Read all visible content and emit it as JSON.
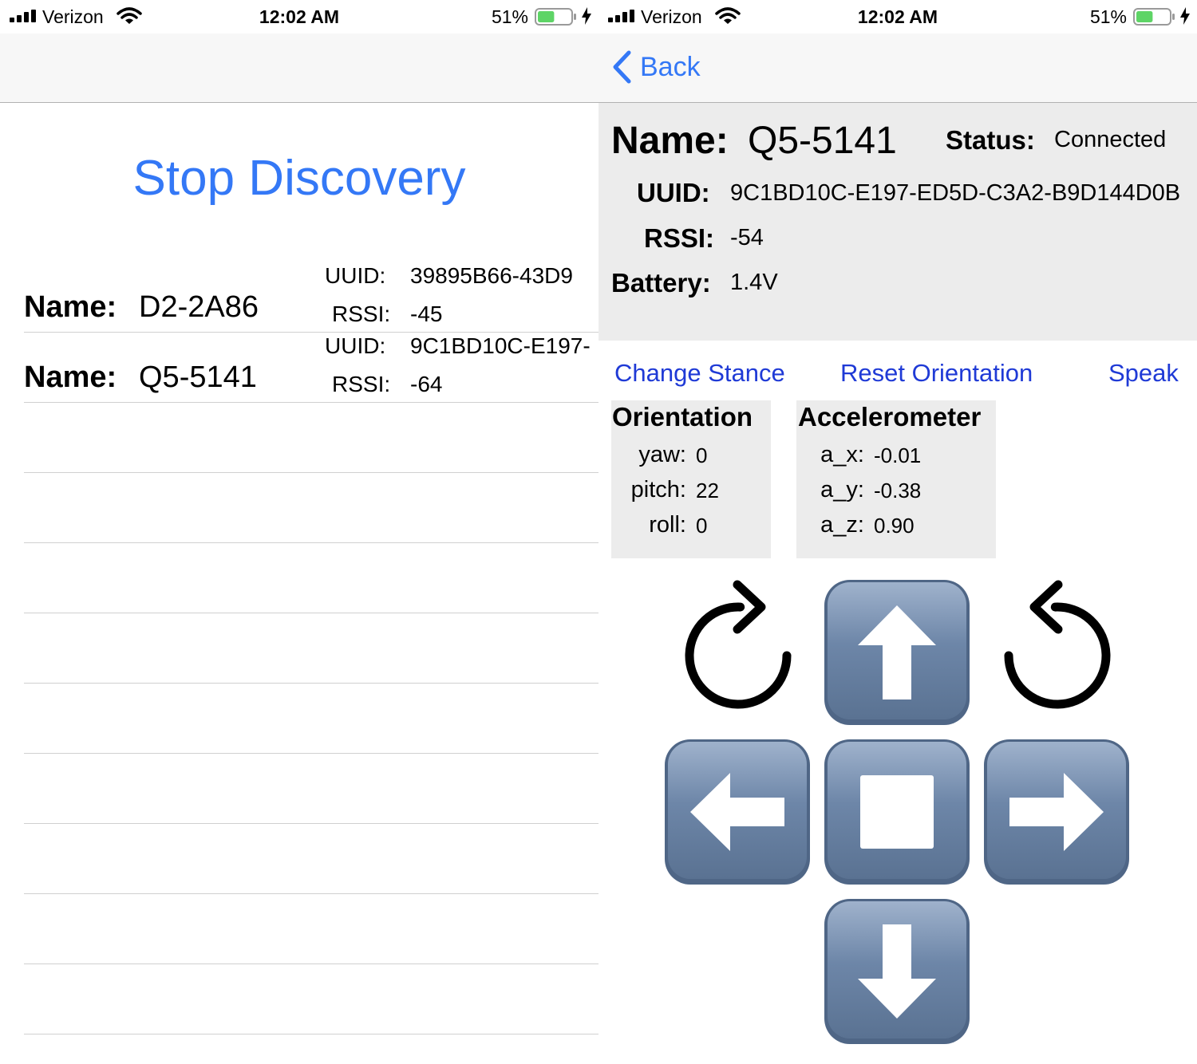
{
  "status_bar": {
    "carrier": "Verizon",
    "time": "12:02 AM",
    "battery_percent": "51%",
    "battery_level": 0.51,
    "battery_color": "#5ed466"
  },
  "discovery": {
    "stop_button": "Stop Discovery",
    "name_label": "Name:",
    "uuid_label": "UUID:",
    "rssi_label": "RSSI:",
    "devices": [
      {
        "name": "D2-2A86",
        "uuid": "39895B66-43D9",
        "rssi": "-45"
      },
      {
        "name": "Q5-5141",
        "uuid": "9C1BD10C-E197-",
        "rssi": "-64"
      }
    ]
  },
  "detail": {
    "back_label": "Back",
    "name_label": "Name:",
    "name_value": "Q5-5141",
    "status_label": "Status:",
    "status_value": "Connected",
    "uuid_label": "UUID:",
    "uuid_value": "9C1BD10C-E197-ED5D-C3A2-B9D144D0B",
    "rssi_label": "RSSI:",
    "rssi_value": "-54",
    "battery_label": "Battery:",
    "battery_value": "1.4V",
    "controls": {
      "change_stance": "Change Stance",
      "reset_orientation": "Reset Orientation",
      "speak": "Speak"
    },
    "orientation": {
      "title": "Orientation",
      "yaw_label": "yaw:",
      "yaw": "0",
      "pitch_label": "pitch:",
      "pitch": "22",
      "roll_label": "roll:",
      "roll": "0"
    },
    "accelerometer": {
      "title": "Accelerometer",
      "ax_label": "a_x:",
      "ax": "-0.01",
      "ay_label": "a_y:",
      "ay": "-0.38",
      "az_label": "a_z:",
      "az": "0.90"
    },
    "pad": {
      "rotate_clockwise": "rotate-clockwise-icon",
      "rotate_counterclockwise": "rotate-counterclockwise-icon",
      "up": "up-arrow-icon",
      "left": "left-arrow-icon",
      "stop": "stop-icon",
      "right": "right-arrow-icon",
      "down": "down-arrow-icon"
    }
  },
  "colors": {
    "ios_blue": "#3478f6",
    "control_blue": "#1f3ad6",
    "info_background": "#ececec",
    "key_blue": "#6a82a3"
  }
}
